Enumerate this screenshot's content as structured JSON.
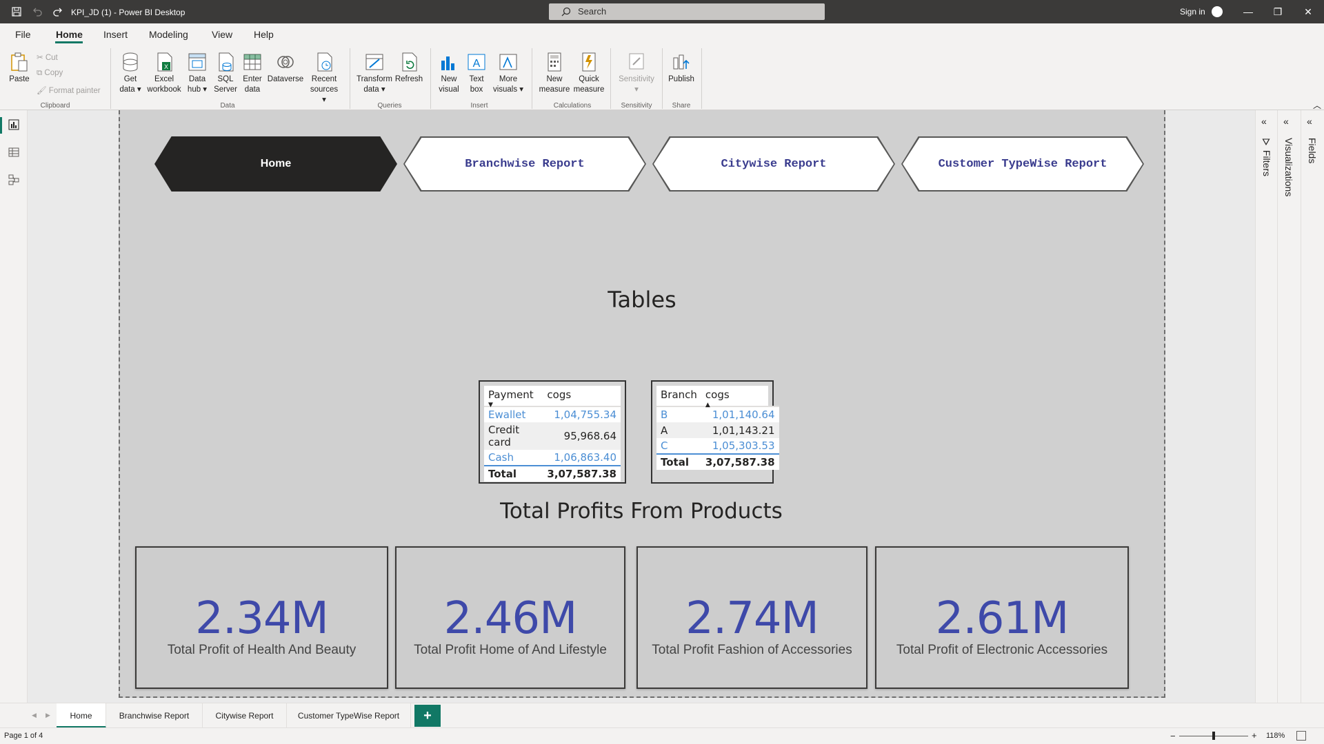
{
  "titlebar": {
    "title": "KPI_JD (1) - Power BI Desktop",
    "search_placeholder": "Search",
    "signin": "Sign in",
    "minimize": "—",
    "restore": "❐",
    "close": "✕"
  },
  "menu": {
    "file": "File",
    "home": "Home",
    "insert": "Insert",
    "modeling": "Modeling",
    "view": "View",
    "help": "Help"
  },
  "ribbon": {
    "paste": "Paste",
    "cut": "Cut",
    "copy": "Copy",
    "format_painter": "Format painter",
    "get_data": "Get data",
    "excel_workbook": "Excel workbook",
    "data_hub": "Data hub",
    "sql_server": "SQL Server",
    "enter_data": "Enter data",
    "dataverse": "Dataverse",
    "recent_sources": "Recent sources",
    "transform_data": "Transform data",
    "refresh": "Refresh",
    "new_visual": "New visual",
    "text_box": "Text box",
    "more_visuals": "More visuals",
    "new_measure": "New measure",
    "quick_measure": "Quick measure",
    "sensitivity": "Sensitivity",
    "publish": "Publish",
    "groups": {
      "clipboard": "Clipboard",
      "data": "Data",
      "queries": "Queries",
      "insert": "Insert",
      "calculations": "Calculations",
      "sensitivity": "Sensitivity",
      "share": "Share"
    }
  },
  "nav_buttons": {
    "home": "Home",
    "branchwise": "Branchwise Report",
    "citywise": "Citywise Report",
    "customer": "Customer TypeWise Report"
  },
  "headings": {
    "tables": "Tables",
    "profits": "Total Profits From Products"
  },
  "payment_table": {
    "col1": "Payment",
    "col2": "cogs",
    "rows": [
      {
        "label": "Ewallet",
        "value": "1,04,755.34"
      },
      {
        "label": "Credit card",
        "value": "95,968.64"
      },
      {
        "label": "Cash",
        "value": "1,06,863.40"
      }
    ],
    "total_label": "Total",
    "total_value": "3,07,587.38"
  },
  "branch_table": {
    "col1": "Branch",
    "col2": "cogs",
    "rows": [
      {
        "label": "B",
        "value": "1,01,140.64"
      },
      {
        "label": "A",
        "value": "1,01,143.21"
      },
      {
        "label": "C",
        "value": "1,05,303.53"
      }
    ],
    "total_label": "Total",
    "total_value": "3,07,587.38"
  },
  "cards": [
    {
      "value": "2.34M",
      "label": "Total Profit of Health And Beauty"
    },
    {
      "value": "2.46M",
      "label": "Total Profit Home of And Lifestyle"
    },
    {
      "value": "2.74M",
      "label": "Total Profit Fashion of Accessories"
    },
    {
      "value": "2.61M",
      "label": "Total Profit of  Electronic Accessories"
    }
  ],
  "panes": {
    "filters": "Filters",
    "visualizations": "Visualizations",
    "fields": "Fields"
  },
  "tabs": {
    "items": [
      "Home",
      "Branchwise Report",
      "Citywise Report",
      "Customer TypeWise Report"
    ],
    "add": "+"
  },
  "status": {
    "page": "Page 1 of 4",
    "zoom": "118%"
  },
  "colors": {
    "accent": "#117865",
    "card_value": "#3e49a9",
    "nav_text": "#3a3c8e",
    "link_row": "#4b8ed4"
  }
}
